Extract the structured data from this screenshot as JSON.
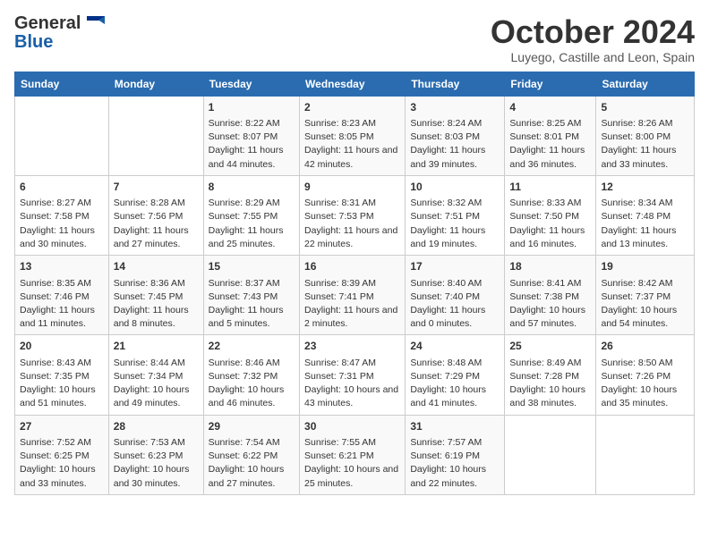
{
  "header": {
    "logo_general": "General",
    "logo_blue": "Blue",
    "title": "October 2024",
    "location": "Luyego, Castille and Leon, Spain"
  },
  "days_of_week": [
    "Sunday",
    "Monday",
    "Tuesday",
    "Wednesday",
    "Thursday",
    "Friday",
    "Saturday"
  ],
  "weeks": [
    [
      {
        "day": "",
        "info": ""
      },
      {
        "day": "",
        "info": ""
      },
      {
        "day": "1",
        "info": "Sunrise: 8:22 AM\nSunset: 8:07 PM\nDaylight: 11 hours and 44 minutes."
      },
      {
        "day": "2",
        "info": "Sunrise: 8:23 AM\nSunset: 8:05 PM\nDaylight: 11 hours and 42 minutes."
      },
      {
        "day": "3",
        "info": "Sunrise: 8:24 AM\nSunset: 8:03 PM\nDaylight: 11 hours and 39 minutes."
      },
      {
        "day": "4",
        "info": "Sunrise: 8:25 AM\nSunset: 8:01 PM\nDaylight: 11 hours and 36 minutes."
      },
      {
        "day": "5",
        "info": "Sunrise: 8:26 AM\nSunset: 8:00 PM\nDaylight: 11 hours and 33 minutes."
      }
    ],
    [
      {
        "day": "6",
        "info": "Sunrise: 8:27 AM\nSunset: 7:58 PM\nDaylight: 11 hours and 30 minutes."
      },
      {
        "day": "7",
        "info": "Sunrise: 8:28 AM\nSunset: 7:56 PM\nDaylight: 11 hours and 27 minutes."
      },
      {
        "day": "8",
        "info": "Sunrise: 8:29 AM\nSunset: 7:55 PM\nDaylight: 11 hours and 25 minutes."
      },
      {
        "day": "9",
        "info": "Sunrise: 8:31 AM\nSunset: 7:53 PM\nDaylight: 11 hours and 22 minutes."
      },
      {
        "day": "10",
        "info": "Sunrise: 8:32 AM\nSunset: 7:51 PM\nDaylight: 11 hours and 19 minutes."
      },
      {
        "day": "11",
        "info": "Sunrise: 8:33 AM\nSunset: 7:50 PM\nDaylight: 11 hours and 16 minutes."
      },
      {
        "day": "12",
        "info": "Sunrise: 8:34 AM\nSunset: 7:48 PM\nDaylight: 11 hours and 13 minutes."
      }
    ],
    [
      {
        "day": "13",
        "info": "Sunrise: 8:35 AM\nSunset: 7:46 PM\nDaylight: 11 hours and 11 minutes."
      },
      {
        "day": "14",
        "info": "Sunrise: 8:36 AM\nSunset: 7:45 PM\nDaylight: 11 hours and 8 minutes."
      },
      {
        "day": "15",
        "info": "Sunrise: 8:37 AM\nSunset: 7:43 PM\nDaylight: 11 hours and 5 minutes."
      },
      {
        "day": "16",
        "info": "Sunrise: 8:39 AM\nSunset: 7:41 PM\nDaylight: 11 hours and 2 minutes."
      },
      {
        "day": "17",
        "info": "Sunrise: 8:40 AM\nSunset: 7:40 PM\nDaylight: 11 hours and 0 minutes."
      },
      {
        "day": "18",
        "info": "Sunrise: 8:41 AM\nSunset: 7:38 PM\nDaylight: 10 hours and 57 minutes."
      },
      {
        "day": "19",
        "info": "Sunrise: 8:42 AM\nSunset: 7:37 PM\nDaylight: 10 hours and 54 minutes."
      }
    ],
    [
      {
        "day": "20",
        "info": "Sunrise: 8:43 AM\nSunset: 7:35 PM\nDaylight: 10 hours and 51 minutes."
      },
      {
        "day": "21",
        "info": "Sunrise: 8:44 AM\nSunset: 7:34 PM\nDaylight: 10 hours and 49 minutes."
      },
      {
        "day": "22",
        "info": "Sunrise: 8:46 AM\nSunset: 7:32 PM\nDaylight: 10 hours and 46 minutes."
      },
      {
        "day": "23",
        "info": "Sunrise: 8:47 AM\nSunset: 7:31 PM\nDaylight: 10 hours and 43 minutes."
      },
      {
        "day": "24",
        "info": "Sunrise: 8:48 AM\nSunset: 7:29 PM\nDaylight: 10 hours and 41 minutes."
      },
      {
        "day": "25",
        "info": "Sunrise: 8:49 AM\nSunset: 7:28 PM\nDaylight: 10 hours and 38 minutes."
      },
      {
        "day": "26",
        "info": "Sunrise: 8:50 AM\nSunset: 7:26 PM\nDaylight: 10 hours and 35 minutes."
      }
    ],
    [
      {
        "day": "27",
        "info": "Sunrise: 7:52 AM\nSunset: 6:25 PM\nDaylight: 10 hours and 33 minutes."
      },
      {
        "day": "28",
        "info": "Sunrise: 7:53 AM\nSunset: 6:23 PM\nDaylight: 10 hours and 30 minutes."
      },
      {
        "day": "29",
        "info": "Sunrise: 7:54 AM\nSunset: 6:22 PM\nDaylight: 10 hours and 27 minutes."
      },
      {
        "day": "30",
        "info": "Sunrise: 7:55 AM\nSunset: 6:21 PM\nDaylight: 10 hours and 25 minutes."
      },
      {
        "day": "31",
        "info": "Sunrise: 7:57 AM\nSunset: 6:19 PM\nDaylight: 10 hours and 22 minutes."
      },
      {
        "day": "",
        "info": ""
      },
      {
        "day": "",
        "info": ""
      }
    ]
  ]
}
